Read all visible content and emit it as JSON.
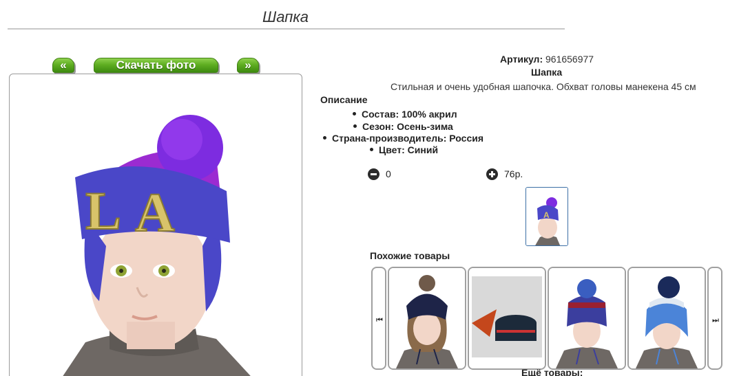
{
  "page": {
    "title": "Шапка"
  },
  "gallery": {
    "prev_label": "«",
    "download_label": "Скачать фото",
    "next_label": "»"
  },
  "product": {
    "sku_label": "Артикул:",
    "sku_value": "961656977",
    "name": "Шапка",
    "description": "Стильная и очень удобная шапочка. Обхват головы манекена 45 см",
    "description_title": "Описание",
    "specs": [
      "Состав: 100% акрил",
      "Сезон: Осень-зима",
      "Страна-производитель: Россия",
      "Цвет: Синий"
    ]
  },
  "cart": {
    "quantity": "0",
    "price": "76р."
  },
  "similar": {
    "title": "Похожие товары",
    "more_title": "Ещё товары:"
  },
  "colors": {
    "button_green": "#5fae22",
    "hat_blue": "#4a47c8",
    "hat_purple": "#9b2bd1"
  }
}
